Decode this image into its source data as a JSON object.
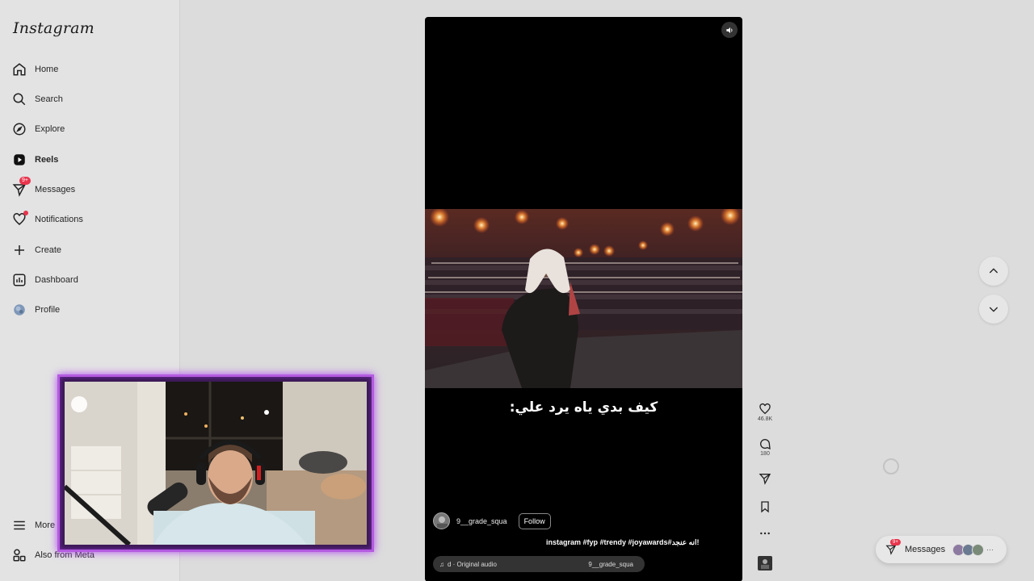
{
  "sidebar": {
    "logo": "Instagram",
    "items": [
      {
        "label": "Home",
        "icon": "home-icon"
      },
      {
        "label": "Search",
        "icon": "search-icon"
      },
      {
        "label": "Explore",
        "icon": "compass-icon"
      },
      {
        "label": "Reels",
        "icon": "reels-icon",
        "active": true
      },
      {
        "label": "Messages",
        "icon": "messenger-icon",
        "badge": "9+"
      },
      {
        "label": "Notifications",
        "icon": "heart-icon"
      },
      {
        "label": "Create",
        "icon": "plus-icon"
      },
      {
        "label": "Dashboard",
        "icon": "dashboard-icon"
      },
      {
        "label": "Profile",
        "icon": "profile-avatar"
      }
    ],
    "more": "More",
    "meta": "Also from Meta"
  },
  "reel": {
    "caption_overlay": "كيف بدي ياه يرد علي:",
    "username": "9__grade_squa",
    "follow_label": "Follow",
    "description": "instagram #fyp #trendy #joyawards#انه عنجد!",
    "audio_label": "d · Original audio",
    "audio_user": "9__grade_squa"
  },
  "actions": {
    "likes": "46.8K",
    "comments": "180"
  },
  "messages_bar": {
    "label": "Messages",
    "badge": "9+"
  },
  "colors": {
    "accent_badge": "#e8344c",
    "webcam_border": "#b45be0"
  }
}
